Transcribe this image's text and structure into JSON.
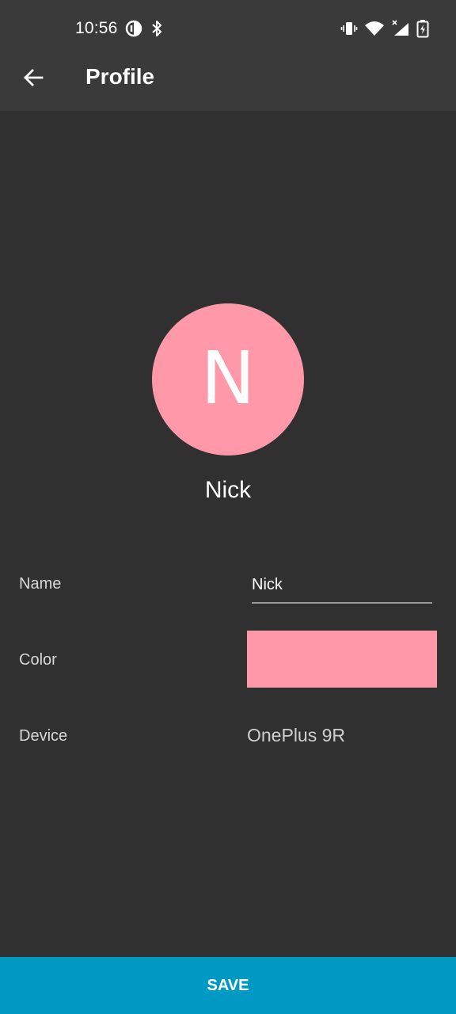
{
  "status_bar": {
    "time": "10:56",
    "left_icons": [
      "data-saver-icon",
      "bluetooth-icon"
    ],
    "right_icons": [
      "vibrate-icon",
      "wifi-icon",
      "cell-signal-icon",
      "battery-charging-icon"
    ]
  },
  "app_bar": {
    "back_icon": "arrow-back-icon",
    "title": "Profile"
  },
  "profile": {
    "initial": "N",
    "name": "Nick",
    "color": "#FF99AA"
  },
  "fields": {
    "name_label": "Name",
    "name_value": "Nick",
    "color_label": "Color",
    "device_label": "Device",
    "device_value": "OnePlus 9R"
  },
  "actions": {
    "save_label": "SAVE",
    "save_color": "#0099C4"
  },
  "theme": {
    "background": "#303030",
    "top_bar": "#3A3A3A"
  }
}
